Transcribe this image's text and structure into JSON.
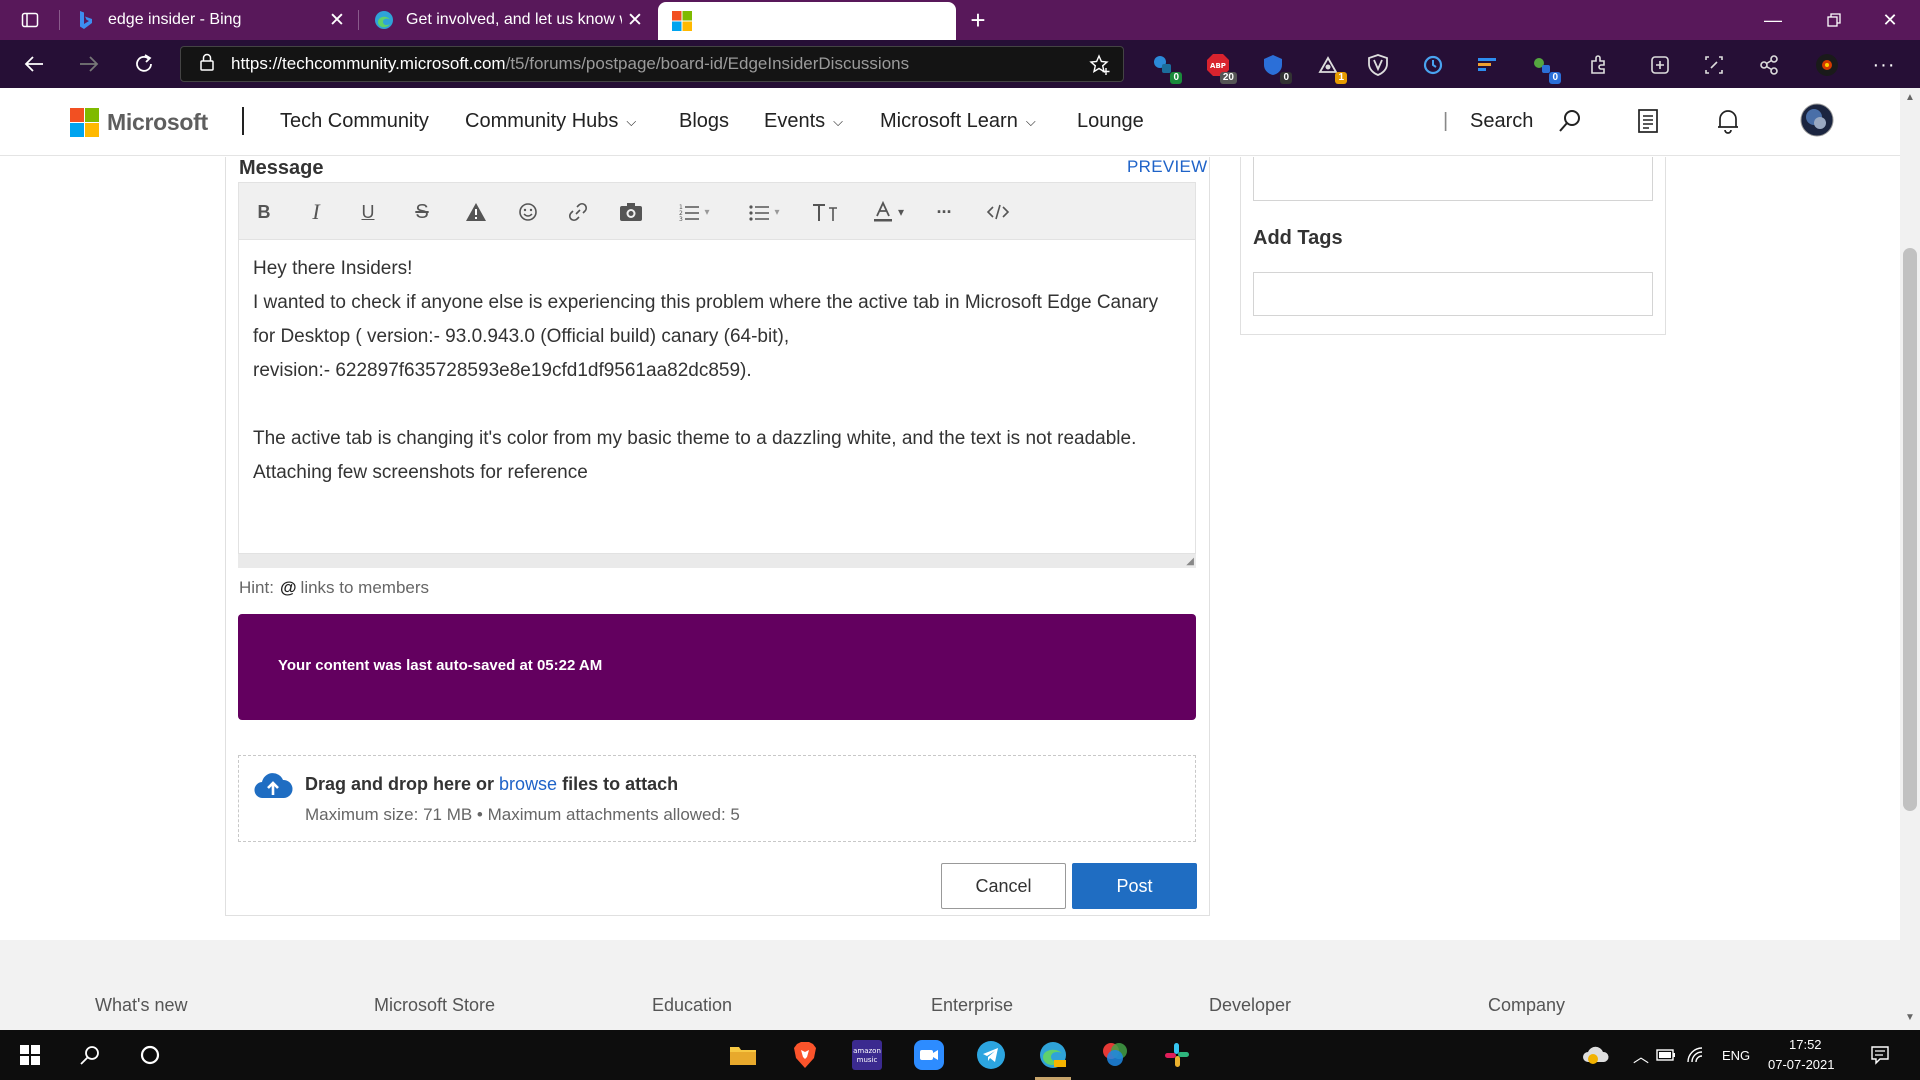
{
  "browser": {
    "tabs": [
      {
        "title": "edge insider - Bing",
        "icon": "bing-icon"
      },
      {
        "title": "Get involved, and let us know wh",
        "icon": "edge-icon"
      },
      {
        "title": "",
        "icon": "microsoft-logo-icon"
      }
    ],
    "url_host": "https://techcommunity.microsoft.com",
    "url_path": "/t5/forums/postpage/board-id/EdgeInsiderDiscussions",
    "extension_badges": {
      "ext1": "0",
      "ext2": "20",
      "ext3": "0",
      "ext4": "1",
      "ext5": "0"
    }
  },
  "header": {
    "brand": "Microsoft",
    "site": "Tech Community",
    "nav": [
      {
        "label": "Community Hubs"
      },
      {
        "label": "Blogs"
      },
      {
        "label": "Events"
      },
      {
        "label": "Microsoft Learn"
      },
      {
        "label": "Lounge"
      }
    ],
    "search_label": "Search"
  },
  "form": {
    "message_label": "Message",
    "preview_label": "PREVIEW",
    "toolbar": [
      "bold",
      "italic",
      "underline",
      "strikethrough",
      "spoiler",
      "emoji",
      "link",
      "photo",
      "numbered-list",
      "bulleted-list",
      "text-size",
      "font-color",
      "more",
      "source-code"
    ],
    "toolbar_glyphs": {
      "bold": "B",
      "italic": "I",
      "underline": "U",
      "strike": "S"
    },
    "body": [
      "Hey there Insiders!",
      "I wanted to check if anyone else is experiencing this problem where the active tab in Microsoft Edge Canary for Desktop ( version:- 93.0.943.0 (Official build) canary (64-bit),",
      "revision:- 622897f635728593e8e19cfd1df9561aa82dc859).",
      "",
      "The active tab is changing it's color from my basic theme to a dazzling white, and the text is not readable. Attaching few screenshots for reference"
    ],
    "hint_label": "Hint:",
    "hint_at": "@",
    "hint_text": "links to members",
    "autosave_text": "Your content was last auto-saved at 05:22 AM",
    "dropzone": {
      "prefix": "Drag and drop here or",
      "link": "browse",
      "suffix": "files to attach",
      "limits": "Maximum size: 71 MB • Maximum attachments allowed: 5"
    },
    "cancel_label": "Cancel",
    "post_label": "Post"
  },
  "sidebar": {
    "tags_label": "Add Tags"
  },
  "footer": {
    "columns": [
      "What's new",
      "Microsoft Store",
      "Education",
      "Enterprise",
      "Developer",
      "Company"
    ]
  },
  "taskbar": {
    "language": "ENG",
    "time": "17:52",
    "date": "07-07-2021"
  },
  "colors": {
    "tab_strip": "#58185a",
    "address_bar": "#260f36",
    "autosave_banner": "#63005f",
    "primary_button": "#1f6dc2",
    "link": "#1f63c8"
  }
}
